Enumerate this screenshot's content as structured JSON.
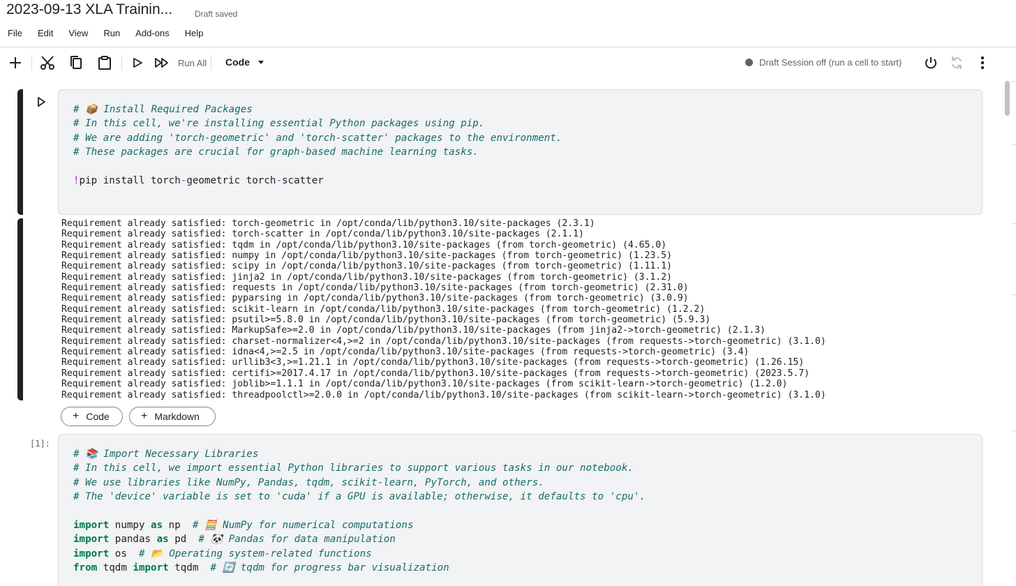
{
  "header": {
    "title": "2023-09-13 XLA Trainin...",
    "status": "Draft saved"
  },
  "menu": [
    "File",
    "Edit",
    "View",
    "Run",
    "Add-ons",
    "Help"
  ],
  "toolbar": {
    "run_all_label": "Run All",
    "cell_type": "Code",
    "session_status": "Draft Session off (run a cell to start)",
    "icons": [
      "add-icon",
      "cut-icon",
      "copy-icon",
      "paste-icon",
      "run-cell-icon",
      "run-all-icon",
      "power-icon",
      "restart-icon",
      "more-vert-icon"
    ]
  },
  "cells": {
    "install": {
      "comments": [
        "# 📦 Install Required Packages",
        "# In this cell, we're installing essential Python packages using pip.",
        "# We are adding 'torch-geometric' and 'torch-scatter' packages to the environment.",
        "# These packages are crucial for graph-based machine learning tasks."
      ],
      "command": {
        "bang": "!",
        "cmd": "pip install torch",
        "dash1": "-",
        "mid": "geometric torch",
        "dash2": "-",
        "end": "scatter"
      },
      "output": [
        "Requirement already satisfied: torch-geometric in /opt/conda/lib/python3.10/site-packages (2.3.1)",
        "Requirement already satisfied: torch-scatter in /opt/conda/lib/python3.10/site-packages (2.1.1)",
        "Requirement already satisfied: tqdm in /opt/conda/lib/python3.10/site-packages (from torch-geometric) (4.65.0)",
        "Requirement already satisfied: numpy in /opt/conda/lib/python3.10/site-packages (from torch-geometric) (1.23.5)",
        "Requirement already satisfied: scipy in /opt/conda/lib/python3.10/site-packages (from torch-geometric) (1.11.1)",
        "Requirement already satisfied: jinja2 in /opt/conda/lib/python3.10/site-packages (from torch-geometric) (3.1.2)",
        "Requirement already satisfied: requests in /opt/conda/lib/python3.10/site-packages (from torch-geometric) (2.31.0)",
        "Requirement already satisfied: pyparsing in /opt/conda/lib/python3.10/site-packages (from torch-geometric) (3.0.9)",
        "Requirement already satisfied: scikit-learn in /opt/conda/lib/python3.10/site-packages (from torch-geometric) (1.2.2)",
        "Requirement already satisfied: psutil>=5.8.0 in /opt/conda/lib/python3.10/site-packages (from torch-geometric) (5.9.3)",
        "Requirement already satisfied: MarkupSafe>=2.0 in /opt/conda/lib/python3.10/site-packages (from jinja2->torch-geometric) (2.1.3)",
        "Requirement already satisfied: charset-normalizer<4,>=2 in /opt/conda/lib/python3.10/site-packages (from requests->torch-geometric) (3.1.0)",
        "Requirement already satisfied: idna<4,>=2.5 in /opt/conda/lib/python3.10/site-packages (from requests->torch-geometric) (3.4)",
        "Requirement already satisfied: urllib3<3,>=1.21.1 in /opt/conda/lib/python3.10/site-packages (from requests->torch-geometric) (1.26.15)",
        "Requirement already satisfied: certifi>=2017.4.17 in /opt/conda/lib/python3.10/site-packages (from requests->torch-geometric) (2023.5.7)",
        "Requirement already satisfied: joblib>=1.1.1 in /opt/conda/lib/python3.10/site-packages (from scikit-learn->torch-geometric) (1.2.0)",
        "Requirement already satisfied: threadpoolctl>=2.0.0 in /opt/conda/lib/python3.10/site-packages (from scikit-learn->torch-geometric) (3.1.0)"
      ]
    },
    "add_code_label": "Code",
    "add_markdown_label": "Markdown",
    "imports": {
      "exec_count": "[1]:",
      "comments": [
        "# 📚 Import Necessary Libraries",
        "# In this cell, we import essential Python libraries to support various tasks in our notebook.",
        "# We use libraries like NumPy, Pandas, tqdm, scikit-learn, PyTorch, and others.",
        "# The 'device' variable is set to 'cuda' if a GPU is available; otherwise, it defaults to 'cpu'."
      ],
      "lines": [
        {
          "kw1": "import",
          "a": " numpy ",
          "kw2": "as",
          "b": " np  ",
          "comment": "# 🧮 NumPy for numerical computations"
        },
        {
          "kw1": "import",
          "a": " pandas ",
          "kw2": "as",
          "b": " pd  ",
          "comment": "# 🐼 Pandas for data manipulation"
        },
        {
          "kw1": "import",
          "a": " os  ",
          "kw2": "",
          "b": "",
          "comment": "# 📂 Operating system-related functions"
        },
        {
          "kw1": "from",
          "a": " tqdm ",
          "kw2": "import",
          "b": " tqdm  ",
          "comment": "# 🔄 tqdm for progress bar visualization"
        }
      ]
    }
  }
}
